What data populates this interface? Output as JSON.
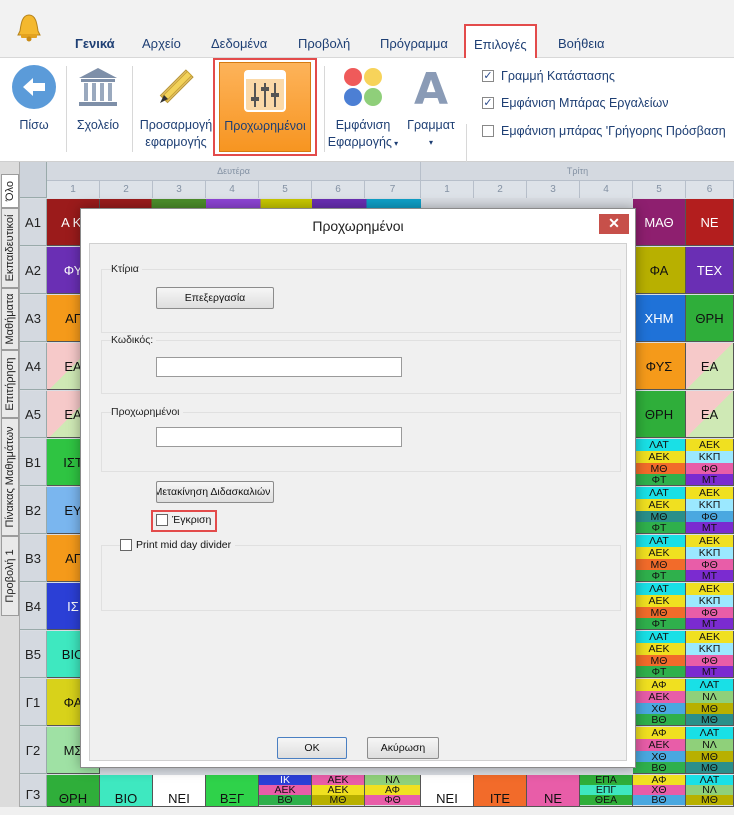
{
  "menu": {
    "tabs": [
      {
        "label": "Γενικά"
      },
      {
        "label": "Αρχείο"
      },
      {
        "label": "Δεδομένα"
      },
      {
        "label": "Προβολή"
      },
      {
        "label": "Πρόγραμμα"
      },
      {
        "label": "Επιλογές"
      },
      {
        "label": "Βοήθεια"
      }
    ]
  },
  "ribbon": {
    "buttons": [
      {
        "label": "Πίσω",
        "icon": "back-arrow-icon"
      },
      {
        "label": "Σχολείο",
        "icon": "school-building-icon"
      },
      {
        "label": "Προσαρμογή εφαρμογής",
        "label1": "Προσαρμογή",
        "label2": "εφαρμογής",
        "icon": "ruler-pencil-icon"
      },
      {
        "label": "Προχωρημένοι",
        "icon": "sliders-icon"
      },
      {
        "label": "Εμφάνιση Εφαρμογής",
        "label1": "Εμφάνιση",
        "label2": "Εφαρμογής",
        "icon": "color-circles-icon"
      },
      {
        "label": "Γραμματ",
        "icon": "font-letter-icon"
      }
    ],
    "checks": [
      {
        "label": "Γραμμή Κατάστασης",
        "checked": true
      },
      {
        "label": "Εμφάνιση Μπάρας Εργαλείων",
        "checked": true
      },
      {
        "label": "Εμφάνιση μπάρας 'Γρήγορης Πρόσβαση",
        "checked": false
      }
    ]
  },
  "side_tabs": [
    "Όλο",
    "Εκπαιδευτικοί",
    "Μαθήματα",
    "Επιτήρηση",
    "Πίνακας Μαθημάτων",
    "Προβολή 1"
  ],
  "grid": {
    "days": [
      "Δευτέρα",
      "Τρίτη"
    ],
    "periods": [
      "1",
      "2",
      "3",
      "4",
      "5",
      "6",
      "7"
    ],
    "periods2": [
      "1",
      "2",
      "3",
      "4",
      "5",
      "6"
    ],
    "rows": [
      "Α1",
      "Α2",
      "Α3",
      "Α4",
      "Α5",
      "Β1",
      "Β2",
      "Β3",
      "Β4",
      "Β5",
      "Γ1",
      "Γ2",
      "Γ3"
    ],
    "left_col": [
      "Α ΚΙ",
      "ΦΥ",
      "ΑΓ",
      "ΕΑ",
      "ΕΑ",
      "ΙΣΤ",
      "ΕΥ",
      "ΑΓ",
      "ΙΣ",
      "ΒΙΟ",
      "ΦΑ",
      "ΜΣ",
      "ΘΡΗ"
    ],
    "col5": [
      "ΜΑΘ",
      "ΦΑ",
      "ΧΗΜ",
      "ΦΥΣ",
      "ΘΡΗ"
    ],
    "col6": [
      "ΝΕ",
      "ΤΕΧ",
      "ΘΡΗ",
      "ΕΑ",
      "ΕΑ"
    ],
    "mini_a": [
      "ΛΑΤ",
      "ΑΕΚ",
      "ΜΘ",
      "ΦΤ"
    ],
    "mini_b": [
      "ΑΕΚ",
      "ΚΚΠ",
      "ΦΘ",
      "ΜΤ"
    ],
    "mini_c": [
      "ΑΦ",
      "ΑΕΚ",
      "ΧΘ",
      "ΒΘ"
    ],
    "mini_d": [
      "ΛΑΤ",
      "ΝΛ",
      "ΜΘ",
      "ΜΘ"
    ],
    "bottom_row": [
      "ΘΡΗ",
      "ΒΙΟ",
      "ΝΕΙ",
      "ΒΞΓ",
      "ΙΚ",
      "ΑΕΚ",
      "ΝΛ",
      "ΝΕΙ",
      "ΙΤΕ",
      "ΝΕ",
      "ΕΠΑ",
      "ΑΦ",
      "ΛΑΤ"
    ],
    "bottom_row_sub": [
      "ΑΕΚ",
      "ΒΘ",
      "ΜΘ",
      "ΑΦ",
      "ΦΘ",
      "ΕΠΓ",
      "ΘΕΑ"
    ]
  },
  "dialog": {
    "title": "Προχωρημένοι",
    "close": "✕",
    "buildings_label": "Κτίρια",
    "edit_button": "Επεξεργασία",
    "code_label": "Κωδικός:",
    "code_value": "",
    "advanced_label": "Προχωρημένοι",
    "advanced_value": "",
    "move_teachers_button": "Μετακίνηση Διδασκαλιών",
    "approval_label": "Έγκριση",
    "approval_checked": false,
    "print_divider_label": "Print mid day divider",
    "print_divider_checked": false,
    "ok_button": "OK",
    "cancel_button": "Ακύρωση"
  }
}
